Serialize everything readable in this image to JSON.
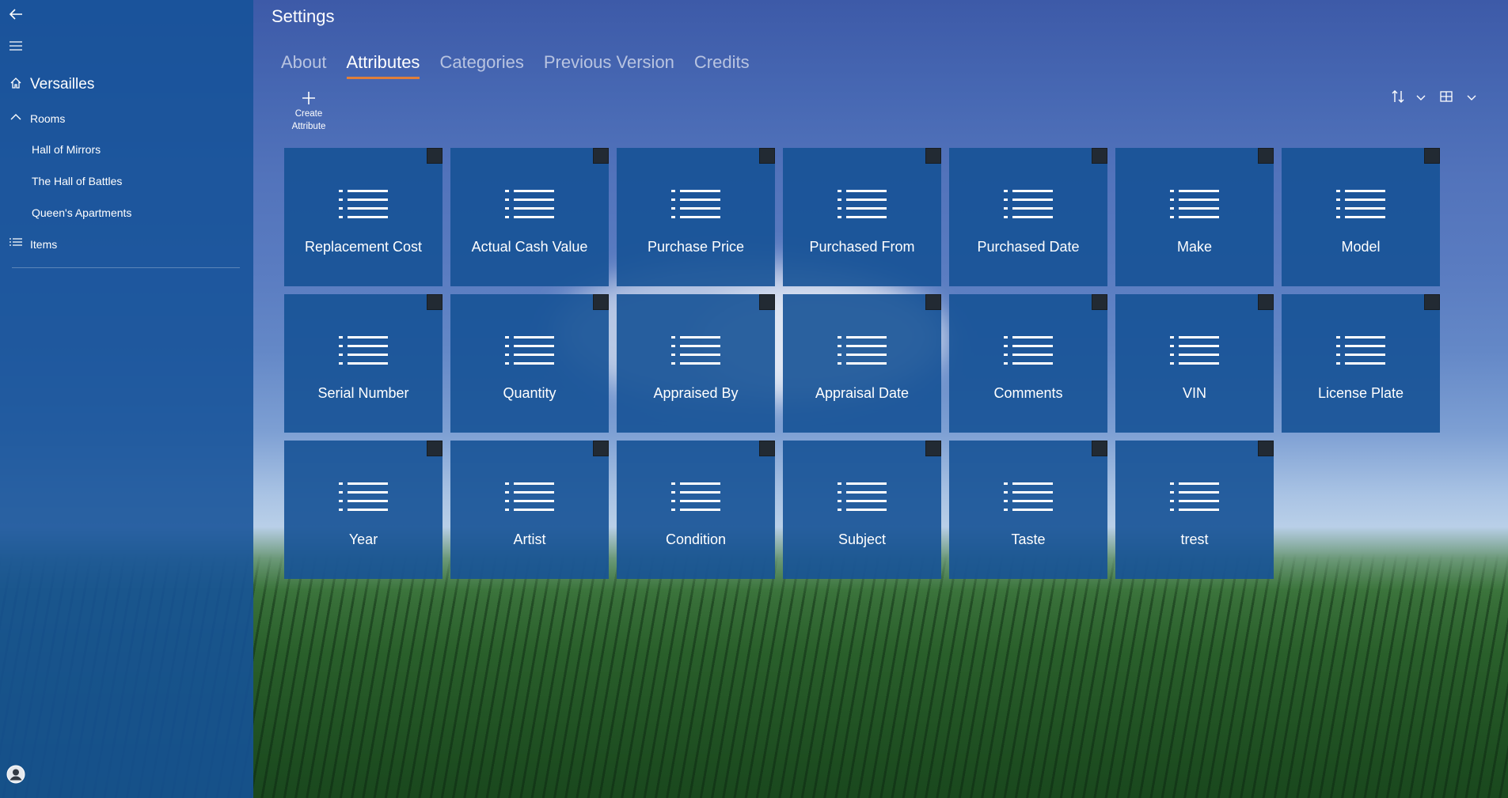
{
  "window": {
    "title": "Settings"
  },
  "sidebar": {
    "project": "Versailles",
    "rooms_label": "Rooms",
    "rooms": [
      {
        "label": "Hall of Mirrors"
      },
      {
        "label": "The Hall of Battles"
      },
      {
        "label": "Queen's Apartments"
      }
    ],
    "items_label": "Items"
  },
  "tabs": [
    {
      "label": "About",
      "active": false
    },
    {
      "label": "Attributes",
      "active": true
    },
    {
      "label": "Categories",
      "active": false
    },
    {
      "label": "Previous Version",
      "active": false
    },
    {
      "label": "Credits",
      "active": false
    }
  ],
  "toolbar": {
    "create_label": "Create Attribute"
  },
  "attributes": [
    {
      "label": "Replacement Cost"
    },
    {
      "label": "Actual Cash Value"
    },
    {
      "label": "Purchase Price"
    },
    {
      "label": "Purchased From"
    },
    {
      "label": "Purchased Date"
    },
    {
      "label": "Make"
    },
    {
      "label": "Model"
    },
    {
      "label": "Serial Number"
    },
    {
      "label": "Quantity"
    },
    {
      "label": "Appraised By"
    },
    {
      "label": "Appraisal Date"
    },
    {
      "label": "Comments"
    },
    {
      "label": "VIN"
    },
    {
      "label": "License Plate"
    },
    {
      "label": "Year"
    },
    {
      "label": "Artist"
    },
    {
      "label": "Condition"
    },
    {
      "label": "Subject"
    },
    {
      "label": "Taste"
    },
    {
      "label": "trest"
    }
  ],
  "icons": {
    "back": "back-arrow-icon",
    "menu": "hamburger-menu-icon",
    "home": "home-icon",
    "rooms": "chevron-up-icon",
    "items": "list-icon",
    "tile": "list-icon",
    "sort": "sort-icon",
    "view": "grid-view-icon",
    "avatar": "user-avatar-icon"
  },
  "colors": {
    "accent": "#e07f3a",
    "tile": "#165296",
    "sidebar": "#165298"
  }
}
